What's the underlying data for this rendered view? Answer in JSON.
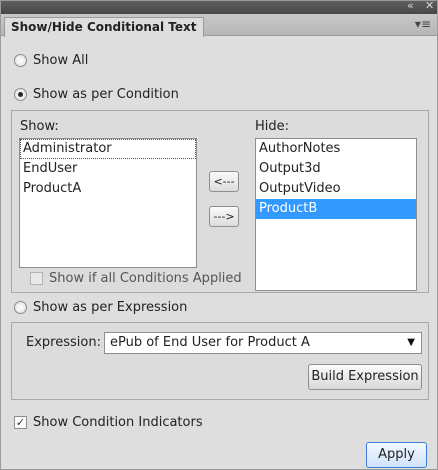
{
  "titlebar": {
    "collapse_icon": "double-left-arrow",
    "close_icon": "close"
  },
  "tab": {
    "label": "Show/Hide Conditional Text",
    "menu_icon": "panel-menu"
  },
  "mode": {
    "show_all_label": "Show All",
    "per_condition_label": "Show as per Condition",
    "per_expression_label": "Show as per Expression",
    "selected": "per_condition"
  },
  "condition_panel": {
    "show_label": "Show:",
    "hide_label": "Hide:",
    "show_items": [
      "Administrator",
      "EndUser",
      "ProductA"
    ],
    "hide_items": [
      "AuthorNotes",
      "Output3d",
      "OutputVideo",
      "ProductB"
    ],
    "selected_hide_item": "ProductB",
    "move_to_show_label": "<---",
    "move_to_hide_label": "--->",
    "all_conditions_label": "Show if all Conditions Applied",
    "all_conditions_checked": false
  },
  "expression_panel": {
    "label": "Expression:",
    "value": "ePub of End User for Product A",
    "build_button": "Build Expression"
  },
  "indicators": {
    "label": "Show Condition Indicators",
    "checked": true
  },
  "apply_button": "Apply",
  "colors": {
    "selection": "#3399ff",
    "panel_bg": "#dedede"
  }
}
